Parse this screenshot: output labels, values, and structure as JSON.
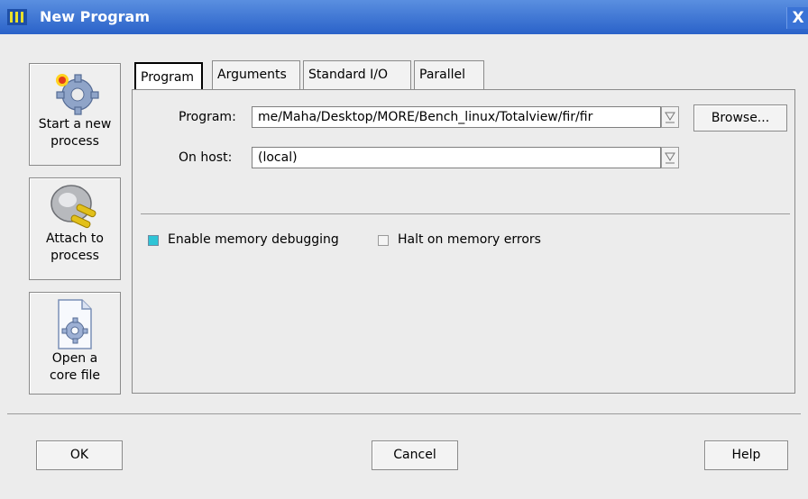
{
  "window": {
    "title": "New Program",
    "close_glyph": "X"
  },
  "sidebar": [
    {
      "name": "start-new-process",
      "label": "Start a new\nprocess",
      "icon": "gear-spark-icon"
    },
    {
      "name": "attach-to-process",
      "label": "Attach to\nprocess",
      "icon": "plug-icon"
    },
    {
      "name": "open-core-file",
      "label": "Open a\ncore file",
      "icon": "gear-document-icon"
    }
  ],
  "tabs": [
    {
      "label": "Program",
      "active": true
    },
    {
      "label": "Arguments",
      "active": false
    },
    {
      "label": "Standard I/O",
      "active": false
    },
    {
      "label": "Parallel",
      "active": false
    }
  ],
  "form": {
    "program_label": "Program:",
    "program_value": "me/Maha/Desktop/MORE/Bench_linux/Totalview/fir/fir",
    "browse_label": "Browse...",
    "host_label": "On host:",
    "host_value": "(local)",
    "enable_memory_debugging": {
      "label": "Enable memory debugging",
      "checked": true
    },
    "halt_on_memory_errors": {
      "label": "Halt on memory errors",
      "checked": false
    }
  },
  "footer": {
    "ok": "OK",
    "cancel": "Cancel",
    "help": "Help"
  },
  "colors": {
    "titlebar": "#2a62c9",
    "check_on": "#2ec4d6",
    "window_bg": "#ececec"
  }
}
